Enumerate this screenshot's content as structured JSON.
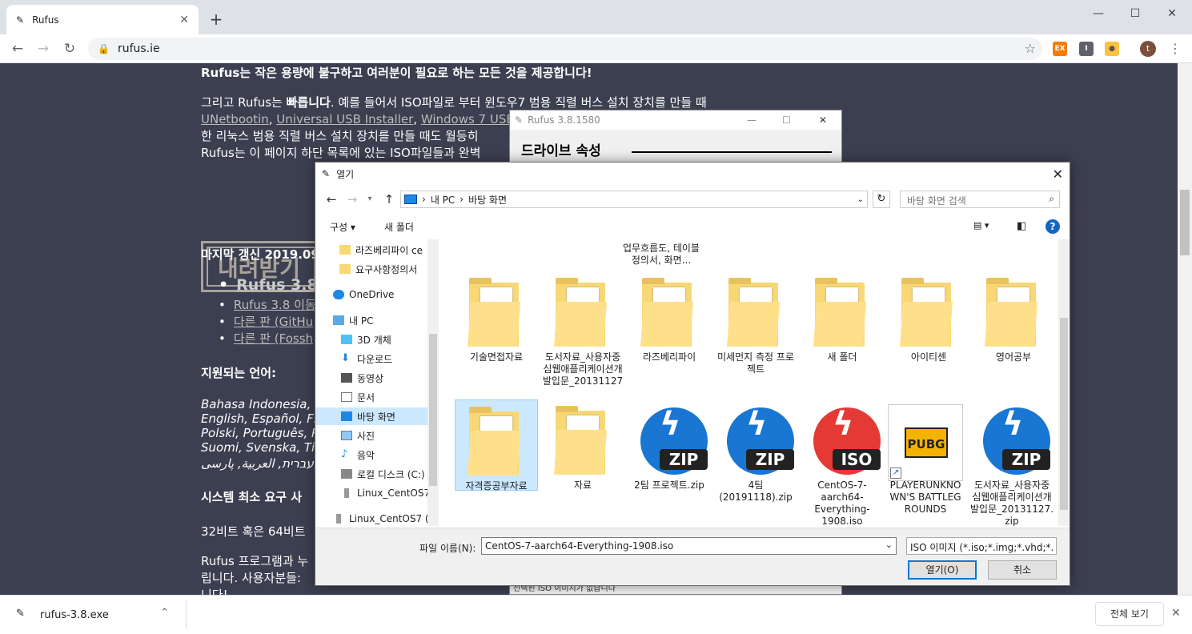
{
  "browser": {
    "tab_title": "Rufus",
    "url": "rufus.ie",
    "new_tab": "+",
    "close_tab": "✕"
  },
  "page": {
    "p1": "Rufus는 작은 용량에 불구하고 여러분이 필요로 하는 모든 것을 제공합니다!",
    "p2a": "그리고 Rufus는 ",
    "p2b": "빠릅니다",
    "p2c": ". 예를 들어서 ISO파일로 부터 윈도우7 범용 직렬 버스 설치 장치를 만들 때",
    "p3_links": [
      "UNetbootin",
      "Universal USB Installer",
      "Windows 7 USB d"
    ],
    "p4": "한 리눅스 범용 직렬 버스 설치 장치를 만들 때도 월등히",
    "p5": "Rufus는 이 페이지 하단 목록에 있는 ISO파일들과 완벽",
    "download_title": "내려받기",
    "last_update": "마지막 갱신 2019.09",
    "list": [
      "Rufus 3.8",
      "Rufus 3.8 이동",
      "다른 판 (GitHu",
      "다른 판 (Fossh"
    ],
    "lang_heading": "지원되는 언어:",
    "lang1": "Bahasa Indonesia, B",
    "lang2": "English, Español, Fr",
    "lang3": "Polski, Português, P",
    "lang4": "Suomi, Svenska, Tiế",
    "lang5": "עברית, العربية, پارسی.",
    "sysreq": "시스템 최소 요구 사",
    "bits": "32비트 혹은 64비트",
    "tail1": "Rufus 프로그램과 누",
    "tail2": "립니다. 사용자분들:",
    "tail3": "니다!"
  },
  "rufus": {
    "title": "Rufus 3.8.1580",
    "header": "드라이브 속성",
    "bottom": "선택된 ISO 이미지가 없습니다"
  },
  "dialog": {
    "title": "열기",
    "path_pc": "내 PC",
    "path_sep": "›",
    "path_folder": "바탕 화면",
    "search_placeholder": "바탕 화면 검색",
    "organize": "구성 ▾",
    "new_folder": "새 폴더",
    "nav": [
      {
        "label": "라즈베리파이 ce",
        "icon": "folder-icon"
      },
      {
        "label": "요구사항정의서",
        "icon": "folder-icon"
      },
      {
        "label": "OneDrive",
        "icon": "cloud-icon"
      },
      {
        "label": "내 PC",
        "icon": "pc-icon"
      },
      {
        "label": "3D 개체",
        "icon": "cube-icon"
      },
      {
        "label": "다운로드",
        "icon": "download-icon"
      },
      {
        "label": "동영상",
        "icon": "video-icon"
      },
      {
        "label": "문서",
        "icon": "document-icon"
      },
      {
        "label": "바탕 화면",
        "icon": "desktop-icon"
      },
      {
        "label": "사진",
        "icon": "picture-icon"
      },
      {
        "label": "음악",
        "icon": "music-icon"
      },
      {
        "label": "로컬 디스크 (C:)",
        "icon": "disk-icon"
      },
      {
        "label": "Linux_CentOS7",
        "icon": "usb-icon"
      },
      {
        "label": "Linux_CentOS7 (D",
        "icon": "usb-icon"
      }
    ],
    "top_partial": "업무흐름도, 테이블정의서, 화면...",
    "files": [
      {
        "label": "기술면접자료",
        "kind": "folder"
      },
      {
        "label": "도서자료_사용자중심웹애플리케이션개발입문_20131127",
        "kind": "folder"
      },
      {
        "label": "라즈베리파이",
        "kind": "folder"
      },
      {
        "label": "미세먼지 측정 프로젝트",
        "kind": "folder"
      },
      {
        "label": "새 폴더",
        "kind": "folder"
      },
      {
        "label": "아이티센",
        "kind": "folder"
      },
      {
        "label": "영어공부",
        "kind": "folder"
      },
      {
        "label": "자격증공부자료",
        "kind": "folder"
      },
      {
        "label": "자료",
        "kind": "folder"
      },
      {
        "label": "2팀 프로젝트.zip",
        "kind": "zip"
      },
      {
        "label": "4팀(20191118).zip",
        "kind": "zip"
      },
      {
        "label": "CentOS-7-aarch64-Everything-1908.iso",
        "kind": "iso"
      },
      {
        "label": "PLAYERUNKNOWN'S BATTLEGROUNDS",
        "kind": "shortcut"
      },
      {
        "label": "도서자료_사용자중심웹애플리케이션개발입문_20131127.zip",
        "kind": "zip"
      }
    ],
    "zip_text": "ZIP",
    "iso_text": "ISO",
    "pubg_text": "PUBG",
    "filename_label": "파일 이름(N):",
    "filename_value": "CentOS-7-aarch64-Everything-1908.iso",
    "filetype": "ISO 이미지 (*.iso;*.img;*.vhd;*.",
    "open_button": "열기(O)",
    "cancel_button": "취소"
  },
  "downloads": {
    "file": "rufus-3.8.exe",
    "show_all": "전체 보기"
  },
  "colors": {
    "page_bg": "#3c3f50",
    "zip_blue": "#1976d2",
    "iso_red": "#e53935",
    "selected": "#cce8ff"
  }
}
